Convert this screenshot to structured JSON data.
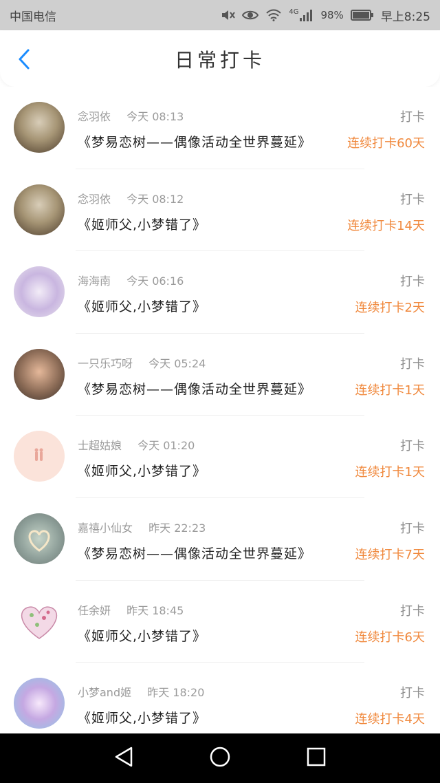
{
  "status_bar": {
    "carrier": "中国电信",
    "network": "4G",
    "battery": "98%",
    "time": "早上8:25",
    "icons": [
      "mute-icon",
      "eye-icon",
      "wifi-icon",
      "signal-icon",
      "battery-icon"
    ]
  },
  "header": {
    "back_icon": "chevron-left-icon",
    "title": "日常打卡"
  },
  "colors": {
    "accent": "#1a8cff",
    "streak": "#f0883c",
    "muted": "#9a9a9a"
  },
  "checkins": [
    {
      "name": "念羽依",
      "time": "今天 08:13",
      "book": "《梦易恋树——偶像活动全世界蔓延》",
      "action": "打卡",
      "streak": "连续打卡60天"
    },
    {
      "name": "念羽依",
      "time": "今天 08:12",
      "book": "《姬师父,小梦错了》",
      "action": "打卡",
      "streak": "连续打卡14天"
    },
    {
      "name": "海海南",
      "time": "今天 06:16",
      "book": "《姬师父,小梦错了》",
      "action": "打卡",
      "streak": "连续打卡2天"
    },
    {
      "name": "一只乐巧呀",
      "time": "今天 05:24",
      "book": "《梦易恋树——偶像活动全世界蔓延》",
      "action": "打卡",
      "streak": "连续打卡1天"
    },
    {
      "name": "士超姑娘",
      "time": "今天 01:20",
      "book": "《姬师父,小梦错了》",
      "action": "打卡",
      "streak": "连续打卡1天"
    },
    {
      "name": "嘉禧小仙女",
      "time": "昨天 22:23",
      "book": "《梦易恋树——偶像活动全世界蔓延》",
      "action": "打卡",
      "streak": "连续打卡7天"
    },
    {
      "name": "任余妍",
      "time": "昨天 18:45",
      "book": "《姬师父,小梦错了》",
      "action": "打卡",
      "streak": "连续打卡6天"
    },
    {
      "name": "小梦and姬",
      "time": "昨天 18:20",
      "book": "《姬师父,小梦错了》",
      "action": "打卡",
      "streak": "连续打卡4天"
    }
  ],
  "bottom_nav": [
    "back-triangle-icon",
    "home-circle-icon",
    "recents-square-icon"
  ]
}
